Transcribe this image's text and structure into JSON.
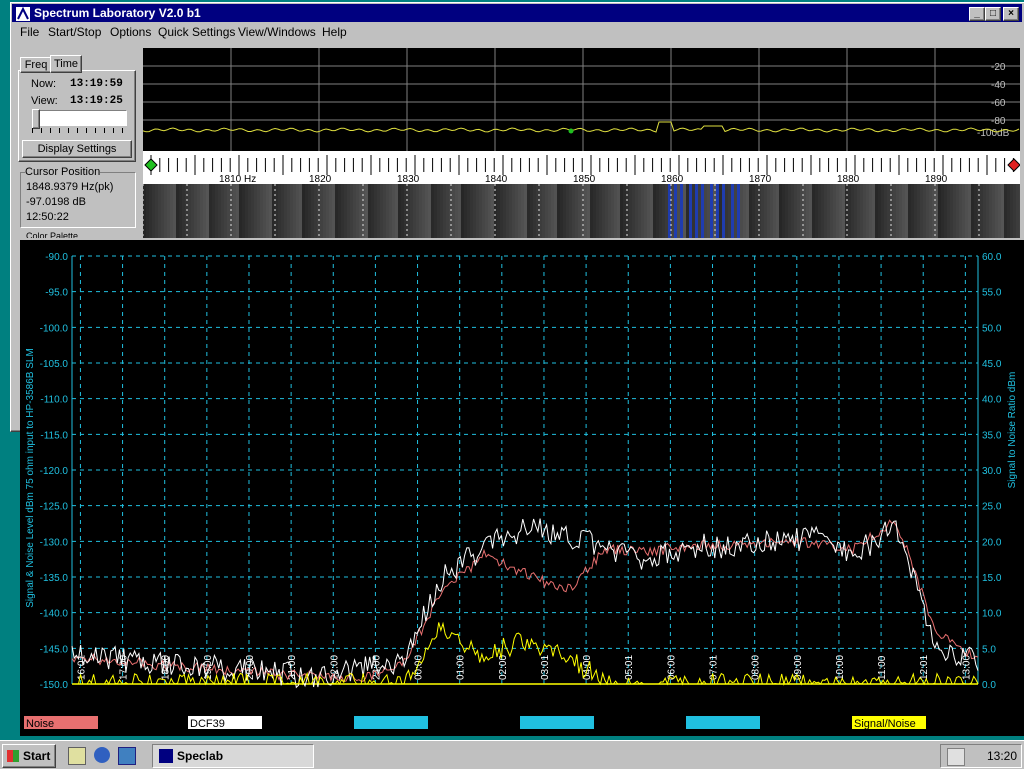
{
  "window": {
    "title": "Spectrum Laboratory V2.0 b1",
    "controls": {
      "minimize": "_",
      "maximize": "□",
      "close": "×"
    }
  },
  "menu": [
    "File",
    "Start/Stop",
    "Options",
    "Quick Settings",
    "View/Windows",
    "Help"
  ],
  "left_panel": {
    "tabs": [
      "Freq",
      "Time"
    ],
    "now_label": "Now:",
    "now_value": "13:19:59",
    "view_label": "View:",
    "view_value": "13:19:25",
    "display_settings_label": "Display Settings",
    "cursor_group_label": "Cursor Position",
    "cursor_freq": "1848.9379 Hz(pk)",
    "cursor_db": "-97.0198 dB",
    "cursor_time": "12:50:22",
    "color_palette_label": "Color Palette"
  },
  "spectrum": {
    "db_ticks": [
      "-20",
      "-40",
      "-60",
      "-80",
      "-100dB"
    ],
    "freq_ticks": [
      "1810 Hz",
      "1820",
      "1830",
      "1840",
      "1850",
      "1860",
      "1870",
      "1880",
      "1890"
    ]
  },
  "chart_data": {
    "type": "line",
    "ylabel_left": "Signal & Noise Level  dBm 75 ohm input to HP-3586B SLM",
    "ylabel_right": "Signal to Noise Ratio   dBm",
    "ylim_left": [
      -150,
      -90
    ],
    "ylim_right": [
      0,
      60
    ],
    "yticks_left": [
      "-90.0",
      "-95.0",
      "-100.0",
      "-105.0",
      "-110.0",
      "-115.0",
      "-120.0",
      "-125.0",
      "-130.0",
      "-135.0",
      "-140.0",
      "-145.0",
      "-150.0"
    ],
    "yticks_right": [
      "60.0",
      "55.0",
      "50.0",
      "45.0",
      "40.0",
      "35.0",
      "30.0",
      "25.0",
      "20.0",
      "15.0",
      "10.0",
      "5.0",
      "0.0"
    ],
    "xticks": [
      "16:01",
      "17:00",
      "18:00",
      "19:00",
      "20:00",
      "21:00",
      "22:00",
      "23:00",
      "00:00",
      "01:00",
      "02:00",
      "03:01",
      "04:00",
      "05:01",
      "06:00",
      "07:01",
      "08:00",
      "09:00",
      "10:00",
      "11:00",
      "12:01",
      "13:00"
    ],
    "grid": true,
    "legend_placement": "bottom",
    "series": [
      {
        "name": "Noise",
        "color": "#e87070",
        "values": [
          -146.5,
          -146.6,
          -147.3,
          -147.6,
          -148.1,
          -148.7,
          -148.9,
          -149.2,
          -147.5,
          -137,
          -132,
          -134.5,
          -137,
          -131,
          -131.5,
          -130.5,
          -130.5,
          -130,
          -130.2,
          -131,
          -127,
          -143,
          -146.5
        ]
      },
      {
        "name": "DCF39",
        "color": "#ffffff",
        "values": [
          -146,
          -146.5,
          -147,
          -147.5,
          -148,
          -148.5,
          -149,
          -148,
          -147,
          -135,
          -131,
          -128,
          -129,
          -131,
          -133,
          -130.5,
          -131,
          -130,
          -129.5,
          -132,
          -127.5,
          -145,
          -147
        ]
      },
      {
        "name": "",
        "color": "#20c0e0",
        "values": []
      },
      {
        "name": "",
        "color": "#20c0e0",
        "values": []
      },
      {
        "name": "",
        "color": "#20c0e0",
        "values": []
      },
      {
        "name": "Signal/Noise",
        "color": "#ffff00",
        "axis": "right",
        "values": [
          0,
          0,
          0,
          0,
          0,
          0,
          0,
          0,
          0,
          8,
          4,
          6,
          4,
          0,
          0,
          0,
          0,
          0,
          0,
          0,
          0,
          0,
          0
        ]
      }
    ]
  },
  "taskbar": {
    "start_label": "Start",
    "app_label": "Speclab",
    "clock": "13:20"
  }
}
